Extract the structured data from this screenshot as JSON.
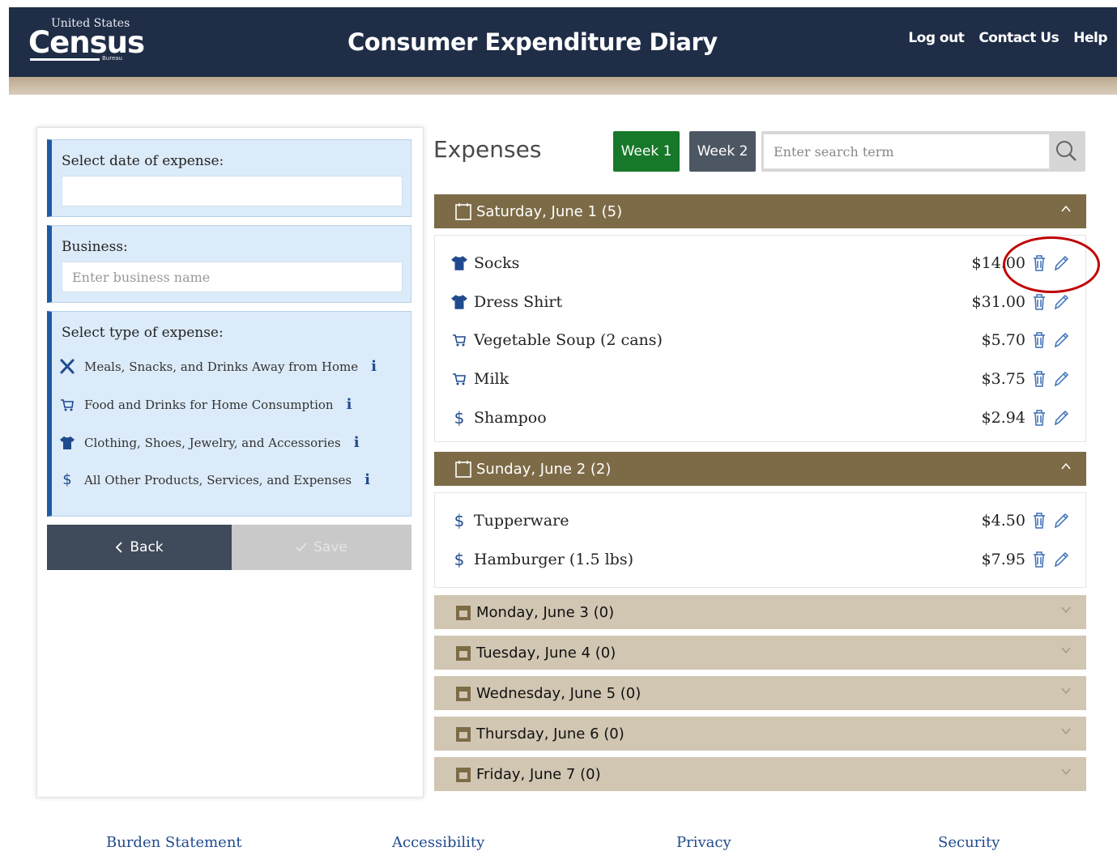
{
  "header": {
    "logo_top": "United States",
    "logo_main": "Census",
    "logo_sub": "Bureau",
    "title": "Consumer Expenditure Diary",
    "links": [
      "Log out",
      "Contact Us",
      "Help"
    ]
  },
  "form": {
    "date_label": "Select date of expense:",
    "date_value": "",
    "business_label": "Business:",
    "business_placeholder": "Enter business name",
    "type_label": "Select type of expense:",
    "types": [
      {
        "icon": "utensils-icon",
        "label": "Meals, Snacks, and Drinks Away from Home",
        "info": "i"
      },
      {
        "icon": "cart-icon",
        "label": "Food and Drinks for Home Consumption",
        "info": "i"
      },
      {
        "icon": "shirt-icon",
        "label": "Clothing, Shoes, Jewelry, and Accessories",
        "info": "i"
      },
      {
        "icon": "dollar-icon",
        "label": "All Other Products, Services, and Expenses",
        "info": "i"
      }
    ],
    "back_label": "Back",
    "save_label": "Save"
  },
  "expenses": {
    "title": "Expenses",
    "week1": "Week 1",
    "week2": "Week 2",
    "search_placeholder": "Enter search term",
    "days": [
      {
        "label": "Saturday, June 1 (5)",
        "open": true,
        "items": [
          {
            "icon": "shirt-icon",
            "name": "Socks",
            "amount": "$14.00"
          },
          {
            "icon": "shirt-icon",
            "name": "Dress Shirt",
            "amount": "$31.00"
          },
          {
            "icon": "cart-icon",
            "name": "Vegetable Soup (2 cans)",
            "amount": "$5.70"
          },
          {
            "icon": "cart-icon",
            "name": "Milk",
            "amount": "$3.75"
          },
          {
            "icon": "dollar-icon",
            "name": "Shampoo",
            "amount": "$2.94"
          }
        ]
      },
      {
        "label": "Sunday, June 2 (2)",
        "open": true,
        "items": [
          {
            "icon": "dollar-icon",
            "name": "Tupperware",
            "amount": "$4.50"
          },
          {
            "icon": "dollar-icon",
            "name": "Hamburger (1.5 lbs)",
            "amount": "$7.95"
          }
        ]
      },
      {
        "label": "Monday, June 3 (0)",
        "open": false
      },
      {
        "label": "Tuesday, June 4 (0)",
        "open": false
      },
      {
        "label": "Wednesday, June 5 (0)",
        "open": false
      },
      {
        "label": "Thursday, June 6 (0)",
        "open": false
      },
      {
        "label": "Friday, June 7 (0)",
        "open": false
      }
    ]
  },
  "footer": {
    "links": [
      "Burden Statement",
      "Accessibility",
      "Privacy",
      "Security"
    ]
  },
  "colors": {
    "header_bg": "#1f2d47",
    "week1_bg": "#17782a",
    "week2_bg": "#4d5663",
    "open_day_bg": "#7d6b47",
    "closed_day_bg": "#d1c6b2",
    "annotation": "#c00000"
  }
}
